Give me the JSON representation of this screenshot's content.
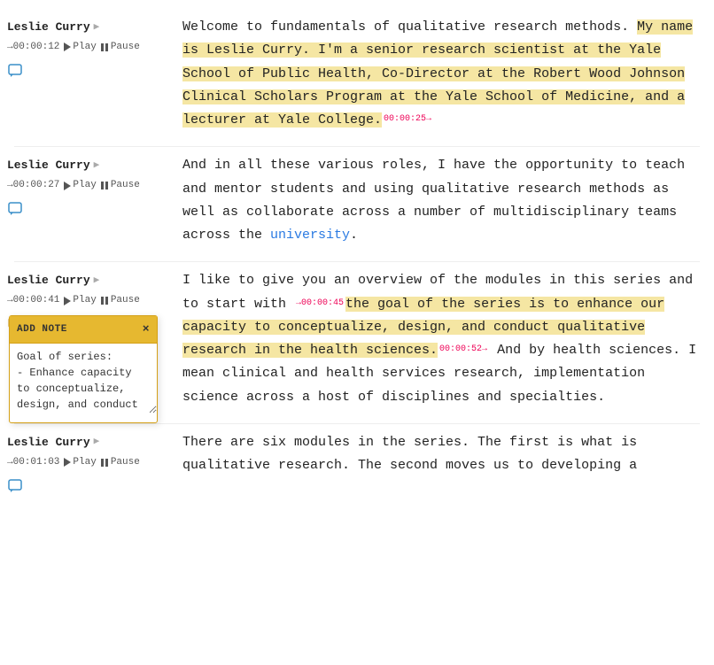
{
  "blocks": [
    {
      "id": "block1",
      "speaker": "Leslie Curry",
      "timestamp": "→00:00:12",
      "play_label": "Play",
      "pause_label": "Pause",
      "note_filled": false,
      "segments": [
        {
          "text": "Welcome to fundamentals of qualitative research methods. ",
          "highlight": "none"
        },
        {
          "text": "My name is Leslie Curry. I'm a senior research scientist at the Yale School of Public Health, Co-Director at the Robert Wood Johnson Clinical Scholars Program at the Yale School of Medicine, and a lecturer at Yale College.",
          "highlight": "yellow"
        },
        {
          "text": " ",
          "highlight": "none"
        },
        {
          "text": "00:00:25→",
          "type": "time_marker"
        }
      ]
    },
    {
      "id": "block2",
      "speaker": "Leslie Curry",
      "timestamp": "→00:00:27",
      "play_label": "Play",
      "pause_label": "Pause",
      "note_filled": false,
      "segments": [
        {
          "text": "And in all these various roles, I have the opportunity to teach and mentor students and using qualitative research methods as well as collaborate across a number of multidisciplinary teams across the ",
          "highlight": "none"
        },
        {
          "text": "university",
          "highlight": "none",
          "type": "link"
        },
        {
          "text": ".",
          "highlight": "none"
        }
      ]
    },
    {
      "id": "block3",
      "speaker": "Leslie Curry",
      "timestamp": "→00:00:41",
      "play_label": "Play",
      "pause_label": "Pause",
      "note_filled": true,
      "note_popup": true,
      "segments": [
        {
          "text": "I like to give you an overview of the modules in this series and to start with ",
          "highlight": "none"
        },
        {
          "text": "00:00:45",
          "type": "time_marker"
        },
        {
          "text": "the goal of the series is to enhance our capacity to conceptualize, design, and conduct qualitative research in the health sciences.",
          "highlight": "yellow"
        },
        {
          "text": " ",
          "highlight": "none"
        },
        {
          "text": "00:00:52→",
          "type": "time_marker"
        },
        {
          "text": " And by health sciences. I mean clinical and health services research, implementation science across a host of disciplines and specialties.",
          "highlight": "none"
        }
      ]
    },
    {
      "id": "block4",
      "speaker": "Leslie Curry",
      "timestamp": "→00:01:03",
      "play_label": "Play",
      "pause_label": "Pause",
      "note_filled": false,
      "segments": [
        {
          "text": "There are six modules in the series. The first is what is qualitative research. The second moves us to developing a",
          "highlight": "none"
        }
      ]
    }
  ],
  "add_note": {
    "header_label": "ADD NOTE",
    "close_label": "×",
    "content": "Goal of series:\n- Enhance capacity to conceptualize, design, and conduct qualitative research in the health sciences"
  },
  "icons": {
    "note_empty_color": "#3a8fc9",
    "note_filled_color": "#e6a817",
    "link_color": "#2a7ae2"
  }
}
